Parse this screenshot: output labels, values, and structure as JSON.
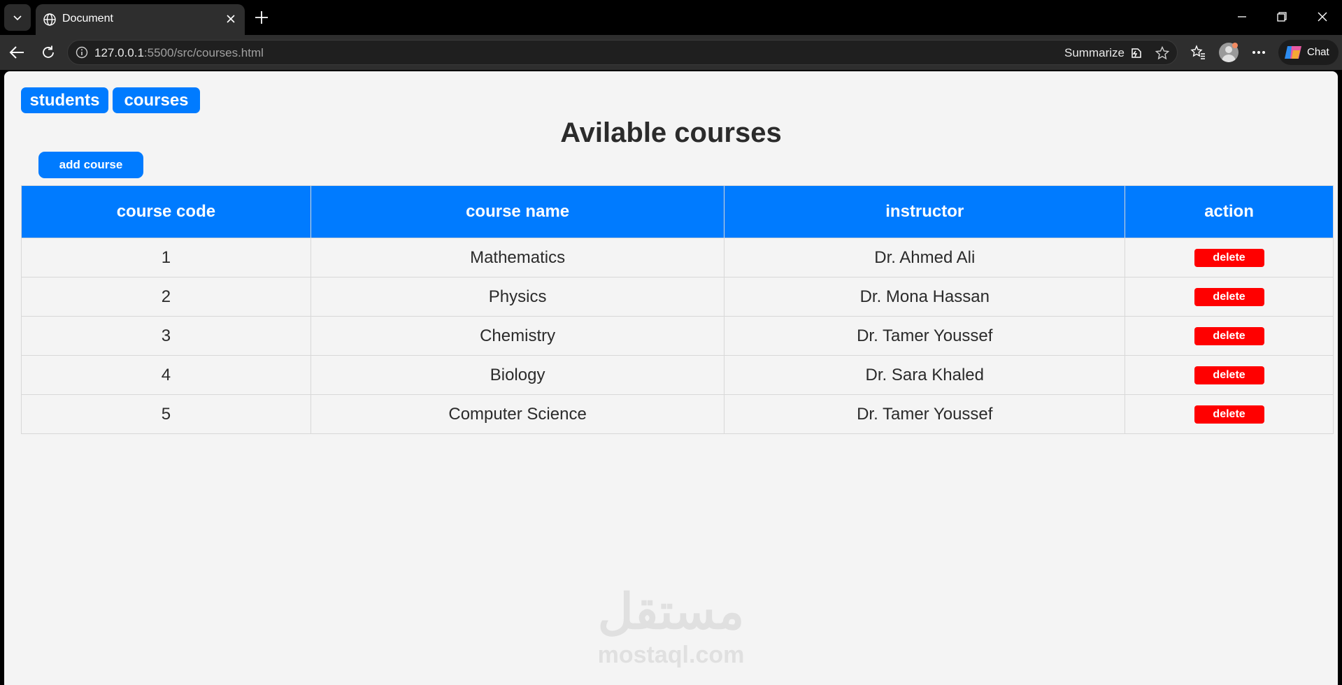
{
  "browser": {
    "tab_title": "Document",
    "url_host": "127.0.0.1",
    "url_rest": ":5500/src/courses.html",
    "summarize_label": "Summarize",
    "chat_label": "Chat"
  },
  "nav": {
    "students_label": "students",
    "courses_label": "courses"
  },
  "page": {
    "title": "Avilable courses",
    "add_button_label": "add course"
  },
  "table": {
    "headers": [
      "course code",
      "course name",
      "instructor",
      "action"
    ],
    "rows": [
      {
        "code": "1",
        "name": "Mathematics",
        "instructor": "Dr. Ahmed Ali",
        "action": "delete"
      },
      {
        "code": "2",
        "name": "Physics",
        "instructor": "Dr. Mona Hassan",
        "action": "delete"
      },
      {
        "code": "3",
        "name": "Chemistry",
        "instructor": "Dr. Tamer Youssef",
        "action": "delete"
      },
      {
        "code": "4",
        "name": "Biology",
        "instructor": "Dr. Sara Khaled",
        "action": "delete"
      },
      {
        "code": "5",
        "name": "Computer Science",
        "instructor": "Dr. Tamer Youssef",
        "action": "delete"
      }
    ]
  },
  "watermark": {
    "arabic": "مستقل",
    "latin": "mostaql.com"
  },
  "colors": {
    "accent": "#007bff",
    "danger": "#ff0000",
    "page_bg": "#f4f4f4"
  }
}
